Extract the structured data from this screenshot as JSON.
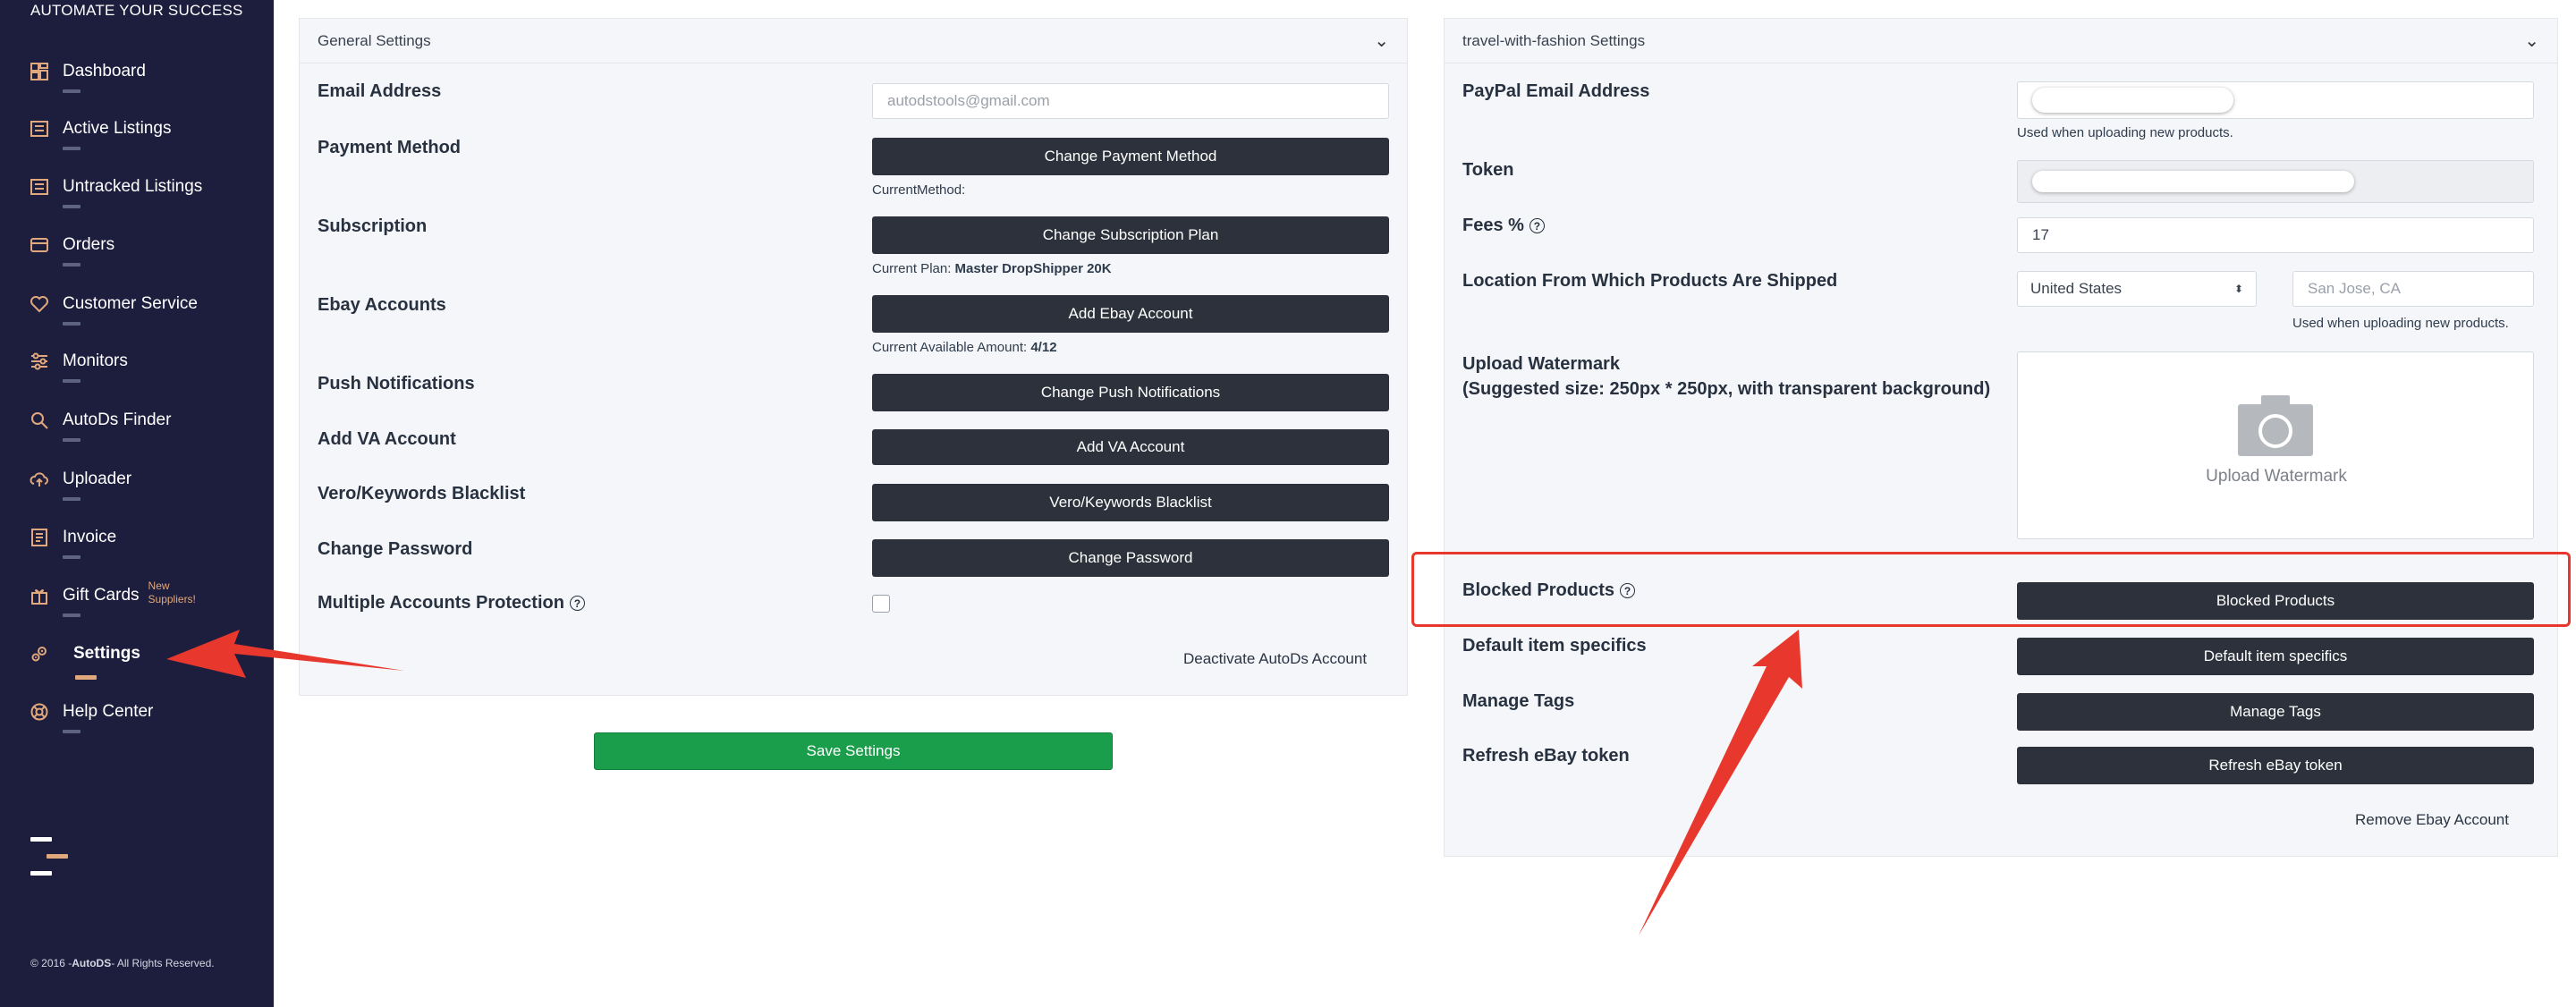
{
  "sidebar": {
    "tagline": "AUTOMATE YOUR SUCCESS",
    "items": [
      {
        "label": "Dashboard",
        "icon": "dashboard-icon"
      },
      {
        "label": "Active Listings",
        "icon": "list-icon"
      },
      {
        "label": "Untracked Listings",
        "icon": "list-icon"
      },
      {
        "label": "Orders",
        "icon": "orders-icon"
      },
      {
        "label": "Customer Service",
        "icon": "heart-icon"
      },
      {
        "label": "Monitors",
        "icon": "sliders-icon"
      },
      {
        "label": "AutoDs Finder",
        "icon": "search-icon"
      },
      {
        "label": "Uploader",
        "icon": "upload-cloud-icon"
      },
      {
        "label": "Invoice",
        "icon": "invoice-icon"
      },
      {
        "label": "Gift Cards",
        "icon": "gift-icon",
        "badge_line1": "New",
        "badge_line2": "Suppliers!"
      },
      {
        "label": "Settings",
        "icon": "gears-icon",
        "active": true
      },
      {
        "label": "Help Center",
        "icon": "lifebuoy-icon"
      }
    ],
    "copyright_prefix": "© 2016 -",
    "copyright_brand": "AutoDS",
    "copyright_suffix": "- All Rights Reserved."
  },
  "general": {
    "title": "General Settings",
    "email_label": "Email Address",
    "email_placeholder": "autodstools@gmail.com",
    "payment_label": "Payment Method",
    "payment_button": "Change Payment Method",
    "current_method": "CurrentMethod:",
    "subscription_label": "Subscription",
    "subscription_button": "Change Subscription Plan",
    "current_plan_prefix": "Current Plan:",
    "current_plan": "Master DropShipper 20K",
    "ebay_label": "Ebay Accounts",
    "ebay_button": "Add Ebay Account",
    "available_prefix": "Current Available Amount:",
    "available_value": "4/12",
    "push_label": "Push Notifications",
    "push_button": "Change Push Notifications",
    "va_label": "Add VA Account",
    "va_button": "Add VA Account",
    "vero_label": "Vero/Keywords Blacklist",
    "vero_button": "Vero/Keywords Blacklist",
    "password_label": "Change Password",
    "password_button": "Change Password",
    "multi_label": "Multiple Accounts Protection",
    "deactivate": "Deactivate AutoDs Account"
  },
  "save_button": "Save Settings",
  "store": {
    "title": "travel-with-fashion Settings",
    "paypal_label": "PayPal Email Address",
    "paypal_hint": "Used when uploading new products.",
    "token_label": "Token",
    "fees_label": "Fees %",
    "fees_value": "17",
    "location_label": "Location From Which Products Are Shipped",
    "country_value": "United States",
    "city_placeholder": "San Jose, CA",
    "location_hint": "Used when uploading new products.",
    "watermark_label": "Upload Watermark",
    "watermark_sub": "(Suggested size: 250px * 250px, with transparent background)",
    "watermark_box_label": "Upload Watermark",
    "blocked_label": "Blocked Products",
    "blocked_button": "Blocked Products",
    "specifics_label": "Default item specifics",
    "specifics_button": "Default item specifics",
    "tags_label": "Manage Tags",
    "tags_button": "Manage Tags",
    "refresh_label": "Refresh eBay token",
    "refresh_button": "Refresh eBay token",
    "remove": "Remove Ebay Account"
  },
  "colors": {
    "sidebar_bg": "#1d1d3d",
    "accent": "#e0a87c",
    "button_dark": "#2c313b",
    "save_green": "#1a9e4b",
    "annotation_red": "#e8382d"
  }
}
